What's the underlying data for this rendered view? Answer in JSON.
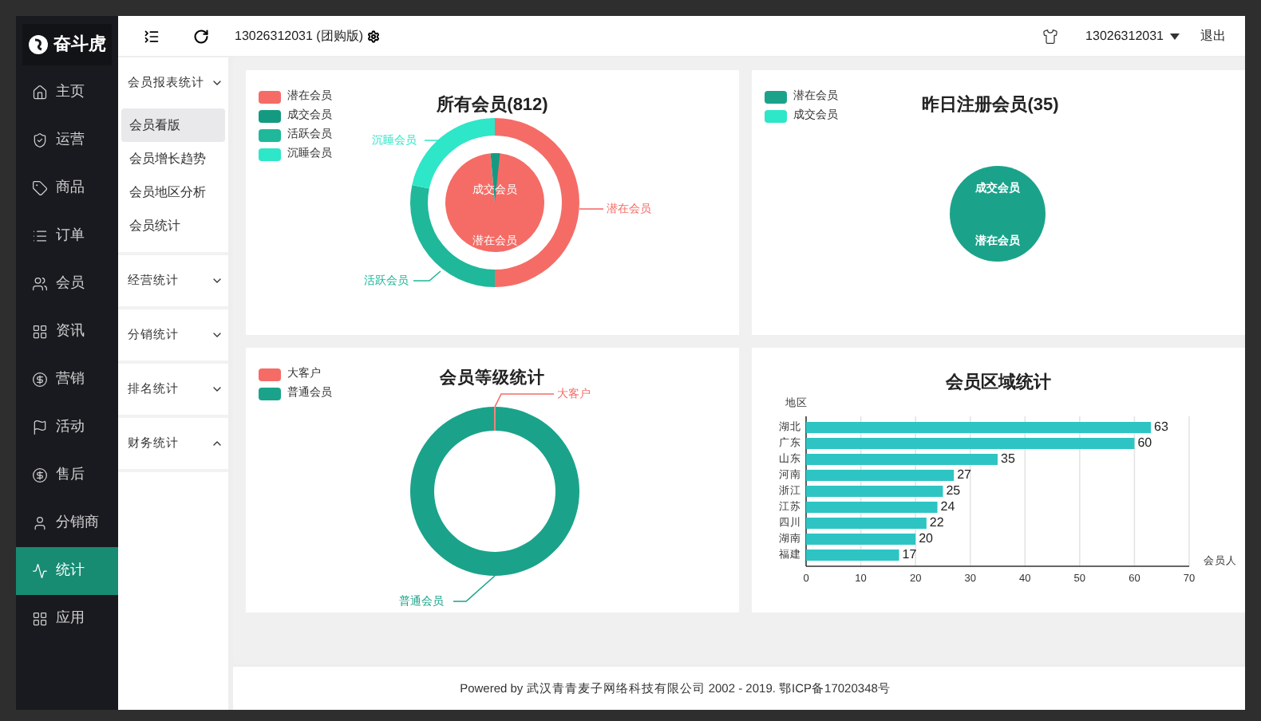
{
  "logo": {
    "text": "奋斗虎"
  },
  "nav": [
    {
      "label": "主页",
      "selected": false
    },
    {
      "label": "运营",
      "selected": false
    },
    {
      "label": "商品",
      "selected": false
    },
    {
      "label": "订单",
      "selected": false
    },
    {
      "label": "会员",
      "selected": false
    },
    {
      "label": "资讯",
      "selected": false
    },
    {
      "label": "营销",
      "selected": false
    },
    {
      "label": "活动",
      "selected": false
    },
    {
      "label": "售后",
      "selected": false
    },
    {
      "label": "分销商",
      "selected": false
    },
    {
      "label": "统计",
      "selected": true
    },
    {
      "label": "应用",
      "selected": false
    }
  ],
  "submenu": [
    {
      "label": "会员报表统计",
      "expanded": false,
      "children": [
        {
          "label": "会员看版",
          "selected": true
        },
        {
          "label": "会员增长趋势",
          "selected": false
        },
        {
          "label": "会员地区分析",
          "selected": false
        },
        {
          "label": "会员统计",
          "selected": false
        }
      ]
    },
    {
      "label": "经营统计",
      "expanded": false
    },
    {
      "label": "分销统计",
      "expanded": false
    },
    {
      "label": "排名统计",
      "expanded": false
    },
    {
      "label": "财务统计",
      "expanded": true
    }
  ],
  "topbar": {
    "store": "13026312031 (团购版)",
    "account": "13026312031",
    "logout": "退出"
  },
  "all_members": {
    "title": "所有会员(812)",
    "legend": [
      {
        "label": "潜在会员",
        "color": "#f56c66"
      },
      {
        "label": "成交会员",
        "color": "#159a82"
      },
      {
        "label": "活跃会员",
        "color": "#1fb89a"
      },
      {
        "label": "沉睡会员",
        "color": "#2ee6c8"
      }
    ],
    "labels": {
      "sleeping": "沉睡会员",
      "potential": "潜在会员",
      "active": "活跃会员",
      "inner_deal": "成交会员",
      "inner_potential": "潜在会员"
    }
  },
  "yesterday": {
    "title": "昨日注册会员(35)",
    "legend": [
      {
        "label": "潜在会员",
        "color": "#1aa38a"
      },
      {
        "label": "成交会员",
        "color": "#2ee6c8"
      }
    ],
    "labels": {
      "deal": "成交会员",
      "potential": "潜在会员"
    }
  },
  "levels": {
    "title": "会员等级统计",
    "legend": [
      {
        "label": "大客户",
        "color": "#f56c66"
      },
      {
        "label": "普通会员",
        "color": "#1aa38a"
      }
    ],
    "labels": {
      "big": "大客户",
      "normal": "普通会员"
    }
  },
  "regions": {
    "chart_data": {
      "type": "bar",
      "orientation": "horizontal",
      "title": "会员区域统计",
      "ylabel": "地区",
      "xlabel": "会员人",
      "categories": [
        "湖北",
        "广东",
        "山东",
        "河南",
        "浙江",
        "江苏",
        "四川",
        "湖南",
        "福建"
      ],
      "series": [
        {
          "color": "#2ec4c4",
          "values": [
            63,
            60,
            35,
            27,
            25,
            24,
            22,
            20,
            17
          ]
        }
      ],
      "xlim": [
        0,
        70
      ],
      "xticks": [
        0,
        10,
        20,
        30,
        40,
        50,
        60,
        70
      ],
      "grid": true,
      "data_labels": true
    }
  },
  "footer": "Powered by 武汉青青麦子网络科技有限公司 2002 - 2019. 鄂ICP备17020348号"
}
